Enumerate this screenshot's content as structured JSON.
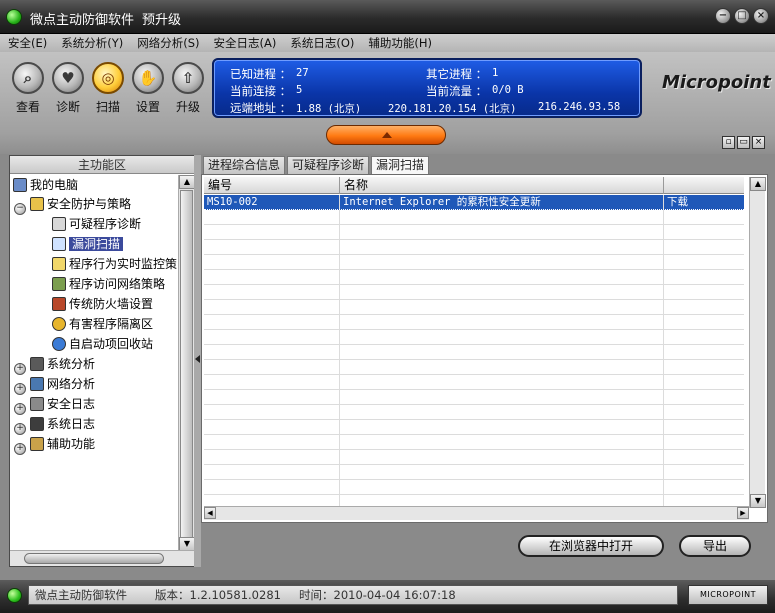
{
  "window": {
    "title": "微点主动防御软件",
    "upgrade_label": "预升级",
    "buttons": [
      "⊖",
      "⊖",
      "⊗"
    ]
  },
  "menu": [
    "安全(E)",
    "系统分析(Y)",
    "网络分析(S)",
    "安全日志(A)",
    "系统日志(O)",
    "辅助功能(H)"
  ],
  "toolbar": {
    "buttons": [
      {
        "label": "查看",
        "icon": "magnifier-icon"
      },
      {
        "label": "诊断",
        "icon": "heart-icon"
      },
      {
        "label": "扫描",
        "icon": "scan-icon"
      },
      {
        "label": "设置",
        "icon": "hand-icon"
      },
      {
        "label": "升级",
        "icon": "upgrade-icon"
      }
    ]
  },
  "status_panel": {
    "known_process_label": "已知进程 ：",
    "known_process_value": "27",
    "other_process_label": "其它进程 ：",
    "other_process_value": "1",
    "connections_label": "当前连接 ：",
    "connections_value": "5",
    "traffic_label": "当前流量 ：",
    "traffic_value": "0/0 B",
    "remote_label": "远端地址 ：",
    "remote_1": "1.88 (北京)",
    "remote_2": "220.181.20.154 (北京)",
    "remote_3": "216.246.93.58"
  },
  "logo": "Micropoint",
  "left_panel": {
    "header": "主功能区",
    "tree": [
      {
        "label": "我的电脑",
        "level": 0
      },
      {
        "label": "安全防护与策略",
        "level": 1,
        "expander": "−"
      },
      {
        "label": "可疑程序诊断",
        "level": 2
      },
      {
        "label": "漏洞扫描",
        "level": 2,
        "selected": true
      },
      {
        "label": "程序行为实时监控策",
        "level": 2
      },
      {
        "label": "程序访问网络策略",
        "level": 2
      },
      {
        "label": "传统防火墙设置",
        "level": 2
      },
      {
        "label": "有害程序隔离区",
        "level": 2
      },
      {
        "label": "自启动项回收站",
        "level": 2
      },
      {
        "label": "系统分析",
        "level": 1,
        "expander": "+"
      },
      {
        "label": "网络分析",
        "level": 1,
        "expander": "+"
      },
      {
        "label": "安全日志",
        "level": 1,
        "expander": "+"
      },
      {
        "label": "系统日志",
        "level": 1,
        "expander": "+"
      },
      {
        "label": "辅助功能",
        "level": 1,
        "expander": "+"
      }
    ]
  },
  "tabs": [
    "进程综合信息",
    "可疑程序诊断",
    "漏洞扫描"
  ],
  "grid": {
    "columns": [
      "编号",
      "名称",
      ""
    ],
    "rows": [
      {
        "id": "MS10-002",
        "name": "Internet Explorer 的累积性安全更新",
        "action": "下载"
      }
    ]
  },
  "buttons": {
    "open_browser": "在浏览器中打开",
    "export": "导出"
  },
  "statusbar": {
    "app": "微点主动防御软件",
    "version": "版本：1.2.10581.0281",
    "time": "时间：2010-04-04 16:07:18",
    "logo": "MICROPOINT"
  }
}
